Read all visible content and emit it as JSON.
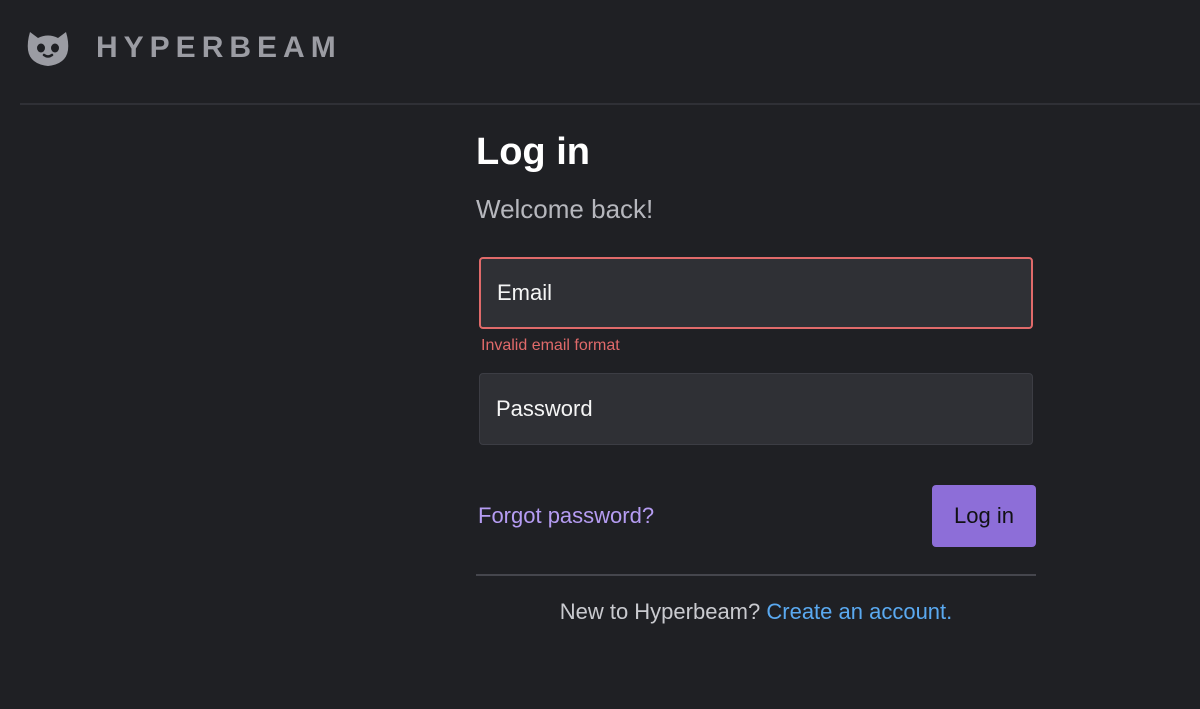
{
  "brand": {
    "name": "HYPERBEAM",
    "icon": "cat-icon"
  },
  "login": {
    "title": "Log in",
    "subtitle": "Welcome back!",
    "email": {
      "placeholder": "Email",
      "value": "",
      "error": "Invalid email format"
    },
    "password": {
      "placeholder": "Password",
      "value": ""
    },
    "forgot_label": "Forgot password?",
    "submit_label": "Log in",
    "signup_prompt": "New to Hyperbeam?",
    "signup_link": "Create an account."
  },
  "colors": {
    "background": "#1f2024",
    "input_background": "#2f3035",
    "error": "#e06a6a",
    "accent": "#8d6ed8",
    "link": "#5aa9f0",
    "forgot_link": "#b59cf2"
  }
}
